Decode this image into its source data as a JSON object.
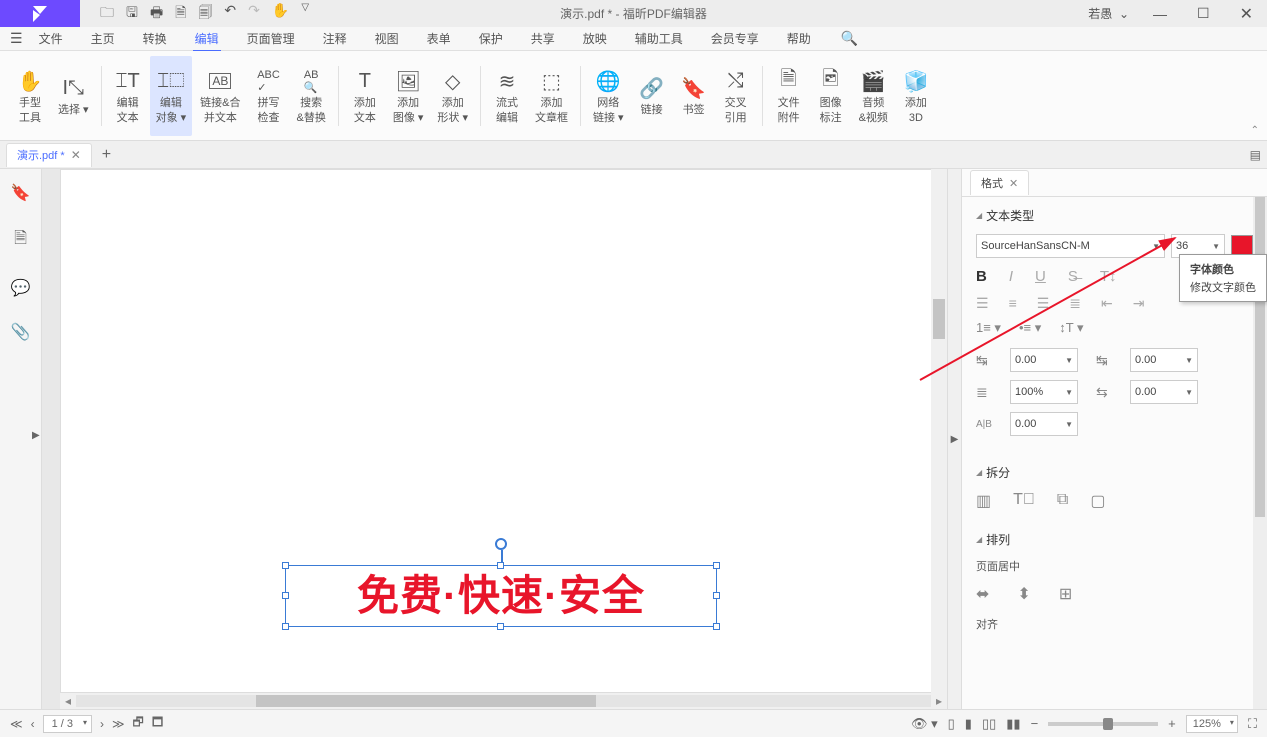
{
  "title": {
    "filename": "演示.pdf *",
    "sep": "-",
    "app": "福昕PDF编辑器"
  },
  "user": "若愚",
  "menu": {
    "file": "文件",
    "home": "主页",
    "convert": "转换",
    "edit": "编辑",
    "page": "页面管理",
    "comment": "注释",
    "view": "视图",
    "form": "表单",
    "protect": "保护",
    "share": "共享",
    "play": "放映",
    "tools": "辅助工具",
    "vip": "会员专享",
    "help": "帮助"
  },
  "ribbon": {
    "hand": "手型\n工具",
    "select": "选择",
    "editText": "编辑\n文本",
    "editObj": "编辑\n对象",
    "linkMerge": "链接&合\n并文本",
    "spell": "拼写\n检查",
    "find": "搜索\n&替换",
    "addText": "添加\n文本",
    "addImg": "添加\n图像",
    "addShape": "添加\n形状",
    "flow": "流式\n编辑",
    "article": "添加\n文章框",
    "weblink": "网络\n链接",
    "link": "链接",
    "bookmark": "书签",
    "xref": "交叉\n引用",
    "attach": "文件\n附件",
    "imgAnnot": "图像\n标注",
    "av": "音频\n&视频",
    "add3d": "添加\n3D"
  },
  "tab": {
    "name": "演示.pdf *"
  },
  "canvas": {
    "text": "免费·快速·安全"
  },
  "panel": {
    "tab": "格式",
    "sect_text": "文本类型",
    "font": "SourceHanSansCN-M",
    "size": "36",
    "sect_split": "拆分",
    "sect_arrange": "排列",
    "pageCenter": "页面居中",
    "align": "对齐",
    "spacing": {
      "indent1": "0.00",
      "indent2": "0.00",
      "line": "100%",
      "char": "0.00",
      "ab": "0.00"
    }
  },
  "tooltip": {
    "title": "字体颜色",
    "desc": "修改文字颜色"
  },
  "status": {
    "page": "1 / 3",
    "zoom": "125%"
  }
}
